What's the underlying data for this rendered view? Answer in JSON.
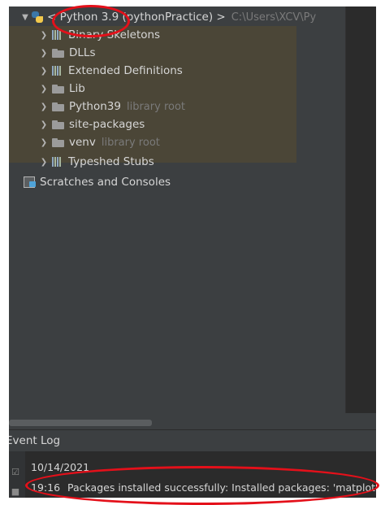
{
  "project_tree": {
    "root": {
      "label": "< Python 3.9 (pythonPractice) >",
      "path": "C:\\Users\\XCV\\Py"
    },
    "items": [
      {
        "label": "Binary Skeletons",
        "icon": "library-icon",
        "note": ""
      },
      {
        "label": "DLLs",
        "icon": "folder-icon",
        "note": ""
      },
      {
        "label": "Extended Definitions",
        "icon": "library-icon",
        "note": ""
      },
      {
        "label": "Lib",
        "icon": "folder-icon",
        "note": ""
      },
      {
        "label": "Python39",
        "icon": "folder-icon",
        "note": "library root"
      },
      {
        "label": "site-packages",
        "icon": "folder-icon",
        "note": ""
      },
      {
        "label": "venv",
        "icon": "folder-icon",
        "note": "library root"
      },
      {
        "label": "Typeshed Stubs",
        "icon": "library-icon",
        "note": ""
      }
    ],
    "scratches": {
      "label": "Scratches and Consoles",
      "icon": "scratches-icon"
    }
  },
  "event_log": {
    "title": "Event Log",
    "date": "10/14/2021",
    "entries": [
      {
        "time": "19:16",
        "message": "Packages installed successfully: Installed packages: 'matplotlib'"
      }
    ]
  },
  "colors": {
    "panel_bg": "#3c3f41",
    "editor_bg": "#2b2b2b",
    "highlight_band": "#4b4637",
    "annotation_red": "#e4101a"
  }
}
